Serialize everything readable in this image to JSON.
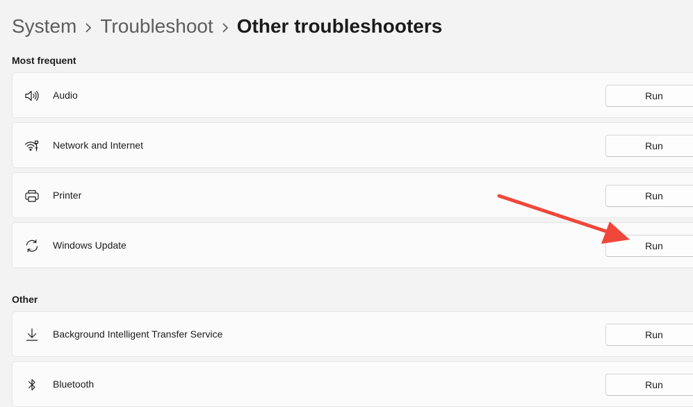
{
  "breadcrumb": {
    "items": [
      "System",
      "Troubleshoot"
    ],
    "current": "Other troubleshooters"
  },
  "sections": {
    "most_frequent": {
      "label": "Most frequent",
      "items": [
        {
          "label": "Audio",
          "icon": "speaker-icon",
          "button": "Run"
        },
        {
          "label": "Network and Internet",
          "icon": "network-icon",
          "button": "Run"
        },
        {
          "label": "Printer",
          "icon": "printer-icon",
          "button": "Run"
        },
        {
          "label": "Windows Update",
          "icon": "refresh-icon",
          "button": "Run"
        }
      ]
    },
    "other": {
      "label": "Other",
      "items": [
        {
          "label": "Background Intelligent Transfer Service",
          "icon": "download-icon",
          "button": "Run"
        },
        {
          "label": "Bluetooth",
          "icon": "bluetooth-icon",
          "button": "Run"
        }
      ]
    }
  },
  "annotation": {
    "arrow_color": "#f0473b",
    "target": "Windows Update Run button"
  }
}
